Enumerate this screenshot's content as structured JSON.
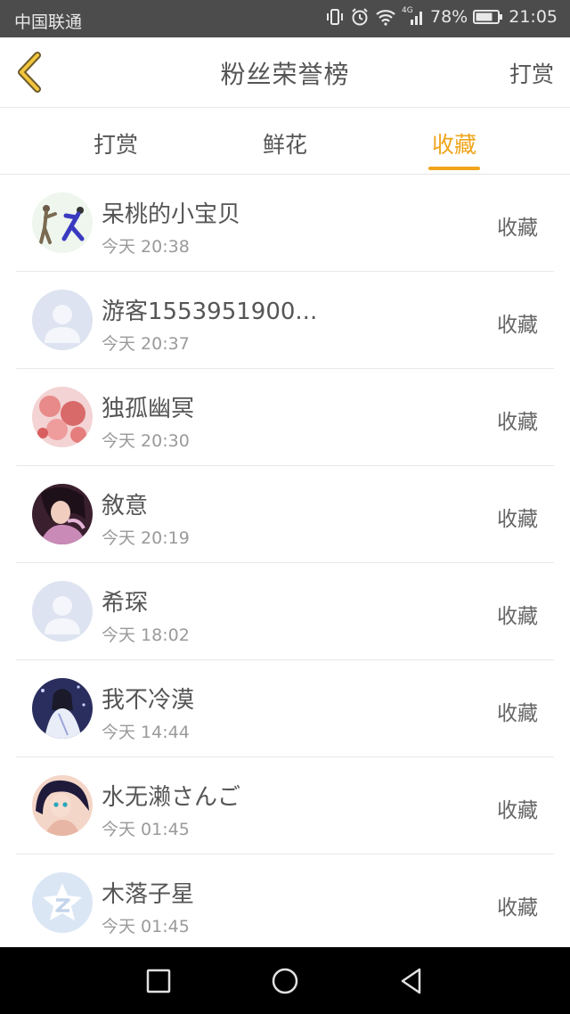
{
  "status_bar": {
    "carrier": "中国联通",
    "network": "4G",
    "battery": "78%",
    "time": "21:05"
  },
  "header": {
    "title": "粉丝荣誉榜",
    "action": "打赏"
  },
  "tabs": [
    {
      "label": "打赏",
      "active": false
    },
    {
      "label": "鲜花",
      "active": false
    },
    {
      "label": "收藏",
      "active": true
    }
  ],
  "fans": [
    {
      "name": "呆桃的小宝贝",
      "time": "今天 20:38",
      "badge": "收藏",
      "avatar": "dancer-avatar"
    },
    {
      "name": "游客1553951900...",
      "time": "今天 20:37",
      "badge": "收藏",
      "avatar": "default-avatar"
    },
    {
      "name": "独孤幽冥",
      "time": "今天 20:30",
      "badge": "收藏",
      "avatar": "flower-avatar"
    },
    {
      "name": "敘意",
      "time": "今天 20:19",
      "badge": "收藏",
      "avatar": "girl-avatar"
    },
    {
      "name": "希琛",
      "time": "今天 18:02",
      "badge": "收藏",
      "avatar": "default-avatar"
    },
    {
      "name": "我不冷漠",
      "time": "今天 14:44",
      "badge": "收藏",
      "avatar": "fantasy-avatar"
    },
    {
      "name": "水无濑さんご",
      "time": "今天 01:45",
      "badge": "收藏",
      "avatar": "anime-avatar"
    },
    {
      "name": "木落子星",
      "time": "今天 01:45",
      "badge": "收藏",
      "avatar": "qzone-avatar"
    }
  ],
  "colors": {
    "accent": "#f0a51c",
    "status_bar": "#4c4c4c",
    "nav_bar": "#000000"
  }
}
